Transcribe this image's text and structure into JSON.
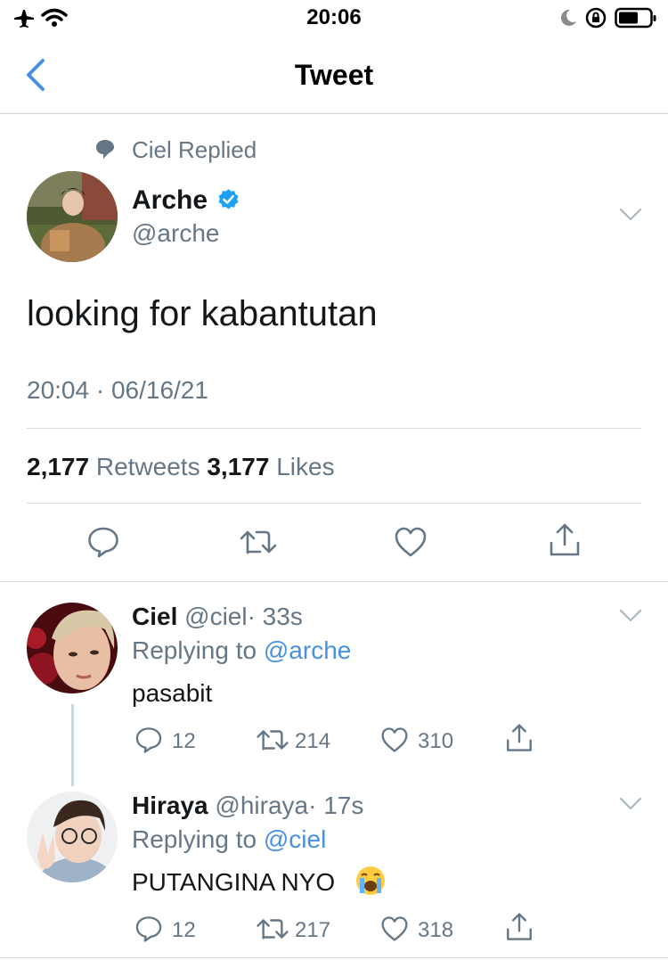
{
  "status_bar": {
    "time": "20:06"
  },
  "nav": {
    "title": "Tweet"
  },
  "context": {
    "text": "Ciel Replied"
  },
  "main_tweet": {
    "name": "Arche",
    "handle": "@arche",
    "text": "looking for kabantutan",
    "timestamp": "20:04 · 06/16/21",
    "retweets_count": "2,177",
    "retweets_label": "Retweets",
    "likes_count": "3,177",
    "likes_label": "Likes"
  },
  "replies": [
    {
      "name": "Ciel",
      "handle": "@ciel",
      "time": "· 33s",
      "replying_prefix": "Replying to",
      "replying_to": "@arche",
      "text": "pasabit",
      "reply_count": "12",
      "retweet_count": "214",
      "like_count": "310"
    },
    {
      "name": "Hiraya",
      "handle": "@hiraya",
      "time": "· 17s",
      "replying_prefix": "Replying to",
      "replying_to": "@ciel",
      "text": "PUTANGINA NYO",
      "reply_count": "12",
      "retweet_count": "217",
      "like_count": "318"
    }
  ],
  "colors": {
    "accent": "#4a90e2",
    "muted": "#657786",
    "text": "#14171a",
    "divider": "#d6dbe0"
  }
}
